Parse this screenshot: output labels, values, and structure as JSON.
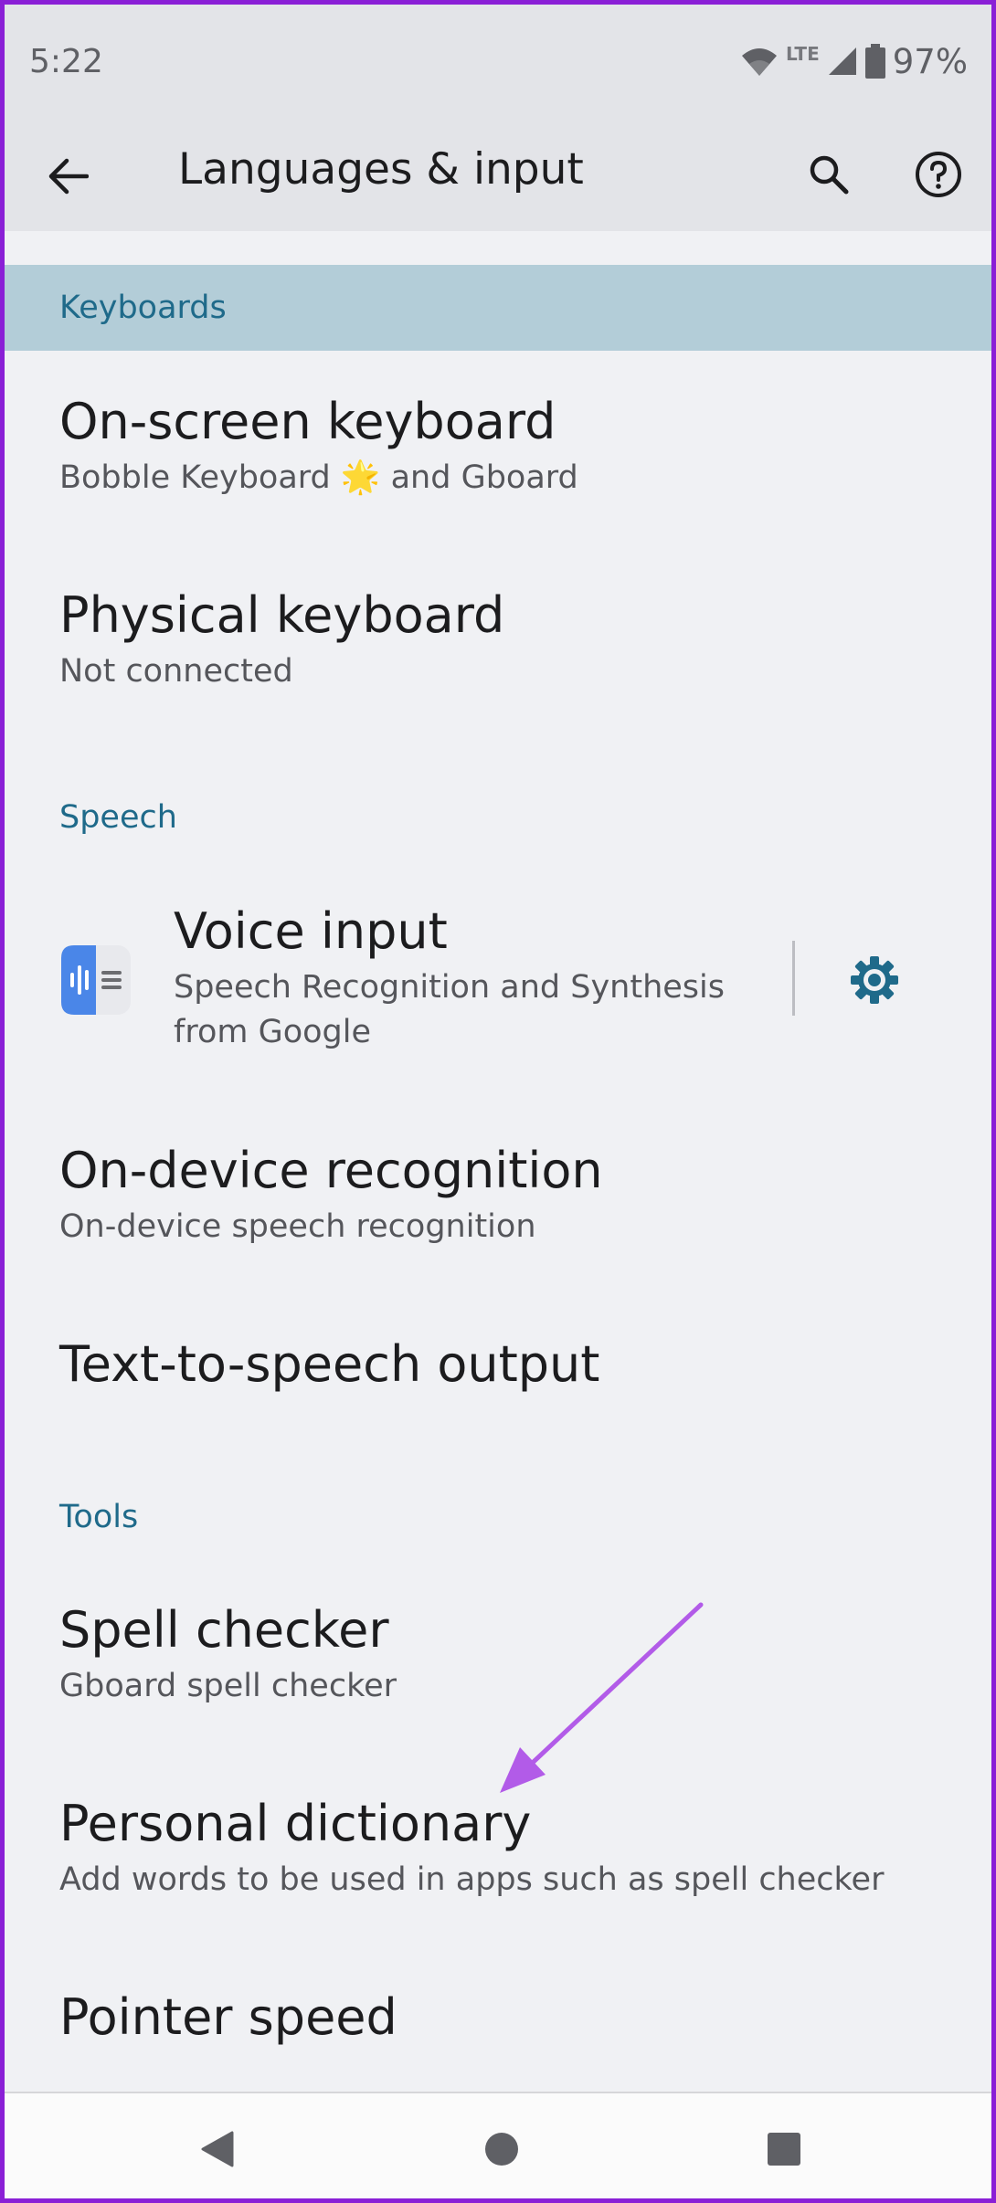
{
  "status": {
    "time": "5:22",
    "network": "LTE",
    "battery": "97%"
  },
  "appbar": {
    "title": "Languages & input",
    "back_icon": "arrow-left-icon",
    "search_icon": "search-icon",
    "help_icon": "help-circle-icon"
  },
  "sections": {
    "keyboards": "Keyboards",
    "speech": "Speech",
    "tools": "Tools"
  },
  "items": {
    "onscreen": {
      "title": "On-screen keyboard",
      "sub": "Bobble Keyboard 🌟 and Gboard"
    },
    "physical": {
      "title": "Physical keyboard",
      "sub": "Not connected"
    },
    "voice": {
      "title": "Voice input",
      "sub": "Speech Recognition and Synthesis from Google"
    },
    "ondevice": {
      "title": "On-device recognition",
      "sub": "On-device speech recognition"
    },
    "tts": {
      "title": "Text-to-speech output"
    },
    "spell": {
      "title": "Spell checker",
      "sub": "Gboard spell checker"
    },
    "dictionary": {
      "title": "Personal dictionary",
      "sub": "Add words to be used in apps such as spell checker"
    },
    "pointer": {
      "title": "Pointer speed"
    }
  },
  "colors": {
    "accent": "#1f6a8a",
    "highlight": "#b3cdd8",
    "annotation_arrow": "#b25be8",
    "frame": "#8a1fd6"
  }
}
